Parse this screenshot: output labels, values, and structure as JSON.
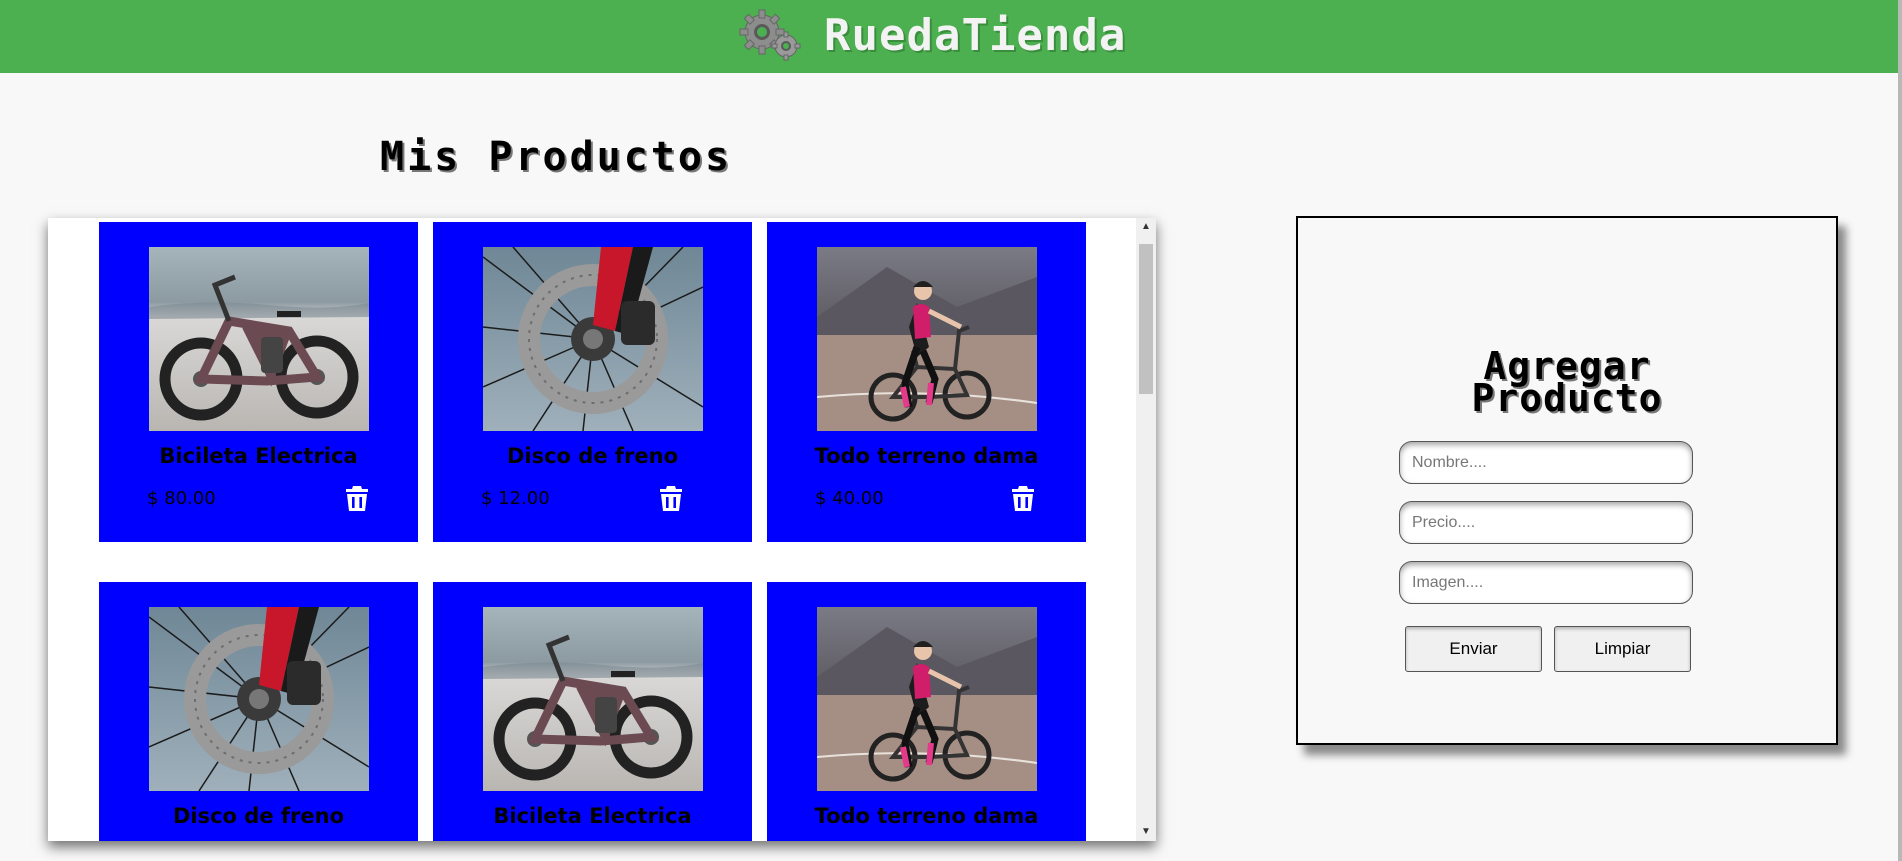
{
  "header": {
    "brand": "RuedaTienda",
    "logo_icon": "gears-icon",
    "color": "#4caf50"
  },
  "main": {
    "title": "Mis Productos"
  },
  "products": [
    {
      "name": "Bicileta Electrica",
      "price": "$ 80.00",
      "image": "electric-bike"
    },
    {
      "name": "Disco de freno",
      "price": "$ 12.00",
      "image": "brake-disc"
    },
    {
      "name": "Todo terreno dama",
      "price": "$ 40.00",
      "image": "mtb-rider"
    },
    {
      "name": "Disco de freno",
      "image": "brake-disc"
    },
    {
      "name": "Bicileta Electrica",
      "image": "electric-bike"
    },
    {
      "name": "Todo terreno dama",
      "image": "mtb-rider"
    }
  ],
  "card_color": "#0000ff",
  "delete_icon": "trash-icon",
  "form": {
    "title_line1": "Agregar",
    "title_line2": "Producto",
    "name_placeholder": "Nombre....",
    "price_placeholder": "Precio....",
    "image_placeholder": "Imagen....",
    "submit_label": "Enviar",
    "clear_label": "Limpiar"
  }
}
